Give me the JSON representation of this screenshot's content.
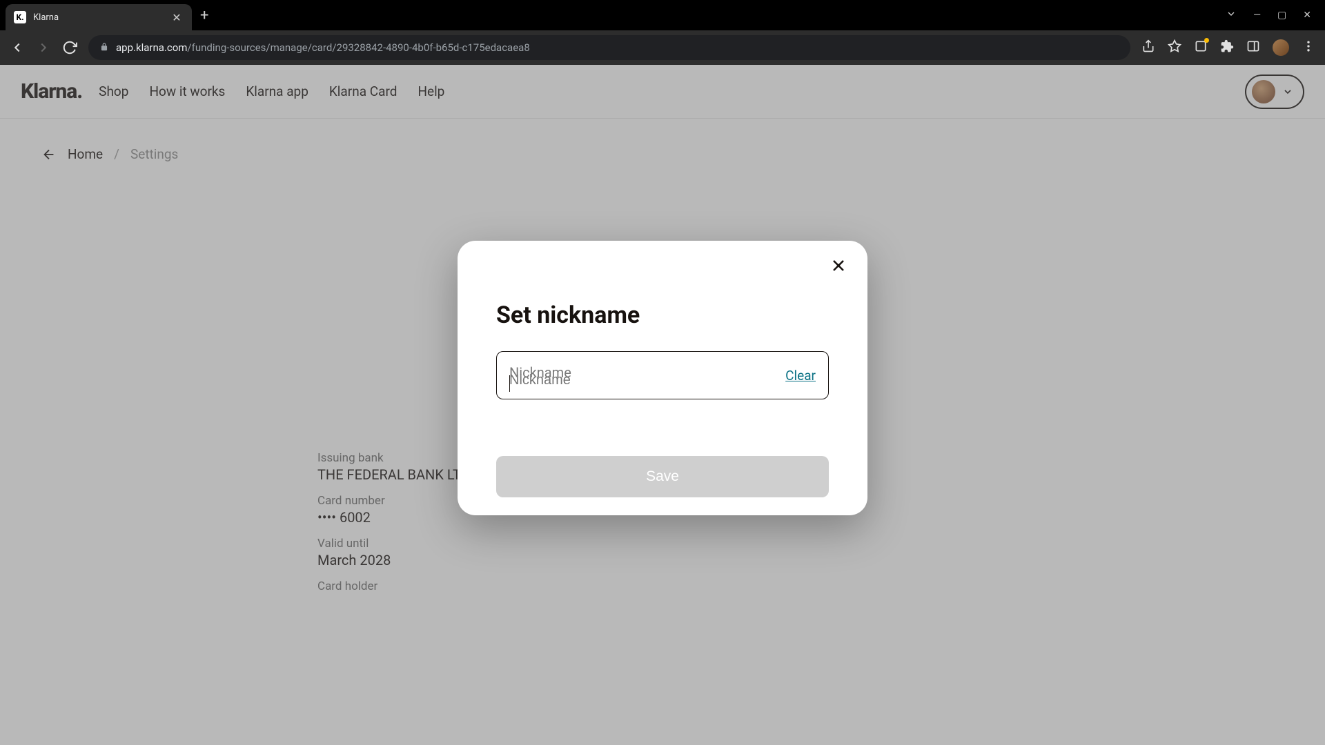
{
  "browser": {
    "tab_title": "Klarna",
    "url_domain": "app.klarna.com",
    "url_path": "/funding-sources/manage/card/29328842-4890-4b0f-b65d-c175edacaea8"
  },
  "header": {
    "logo": "Klarna.",
    "nav": [
      "Shop",
      "How it works",
      "Klarna app",
      "Klarna Card",
      "Help"
    ]
  },
  "breadcrumb": {
    "home": "Home",
    "sep": "/",
    "current": "Settings"
  },
  "card_details": {
    "bank_label": "Issuing bank",
    "bank_value": "THE FEDERAL BANK LTD",
    "number_label": "Card number",
    "number_value": "•••• 6002",
    "valid_label": "Valid until",
    "valid_value": "March 2028",
    "holder_label": "Card holder"
  },
  "modal": {
    "title": "Set nickname",
    "placeholder": "Nickname",
    "clear": "Clear",
    "save": "Save"
  }
}
